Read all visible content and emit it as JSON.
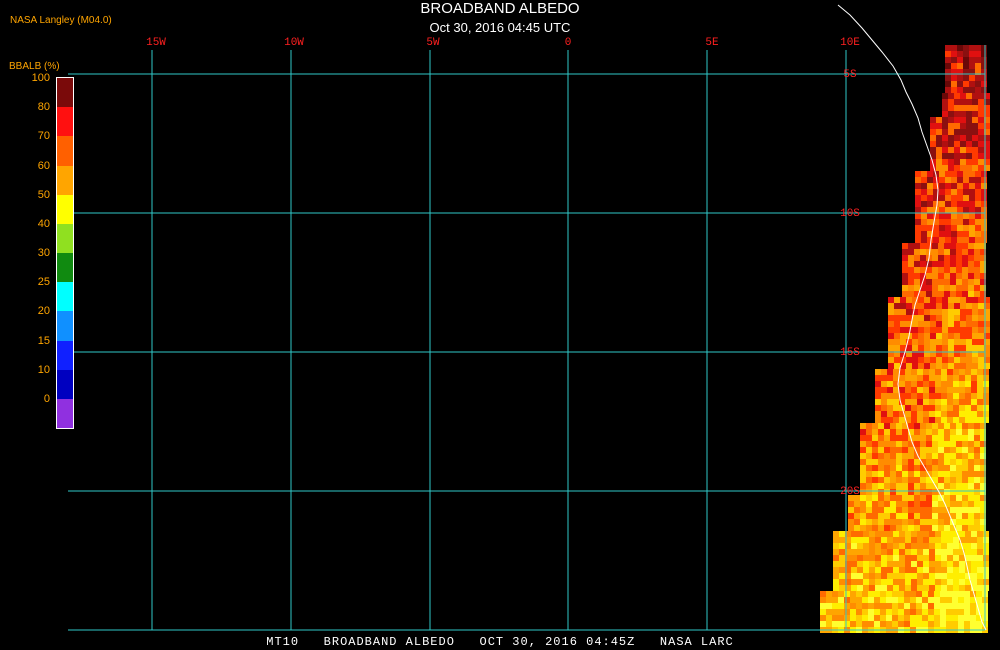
{
  "header": {
    "credit": "NASA Langley (M04.0)",
    "title": "BROADBAND ALBEDO",
    "subtitle": "Oct 30, 2016 04:45 UTC"
  },
  "legend": {
    "title": "BBALB (%)",
    "labels": [
      "100",
      "80",
      "70",
      "60",
      "50",
      "40",
      "30",
      "25",
      "20",
      "15",
      "10",
      "0"
    ],
    "colors": [
      "#7a0a0a",
      "#ff1010",
      "#ff6000",
      "#ffa500",
      "#ffff00",
      "#90e020",
      "#108a10",
      "#00ffff",
      "#1090ff",
      "#1020ff",
      "#0000c0",
      "#9030e0"
    ]
  },
  "grid": {
    "lon_labels": [
      "15W",
      "10W",
      "5W",
      "0",
      "5E",
      "10E"
    ],
    "lat_labels": [
      "5S",
      "10S",
      "15S",
      "20S"
    ],
    "grid_color": "#30c8c8"
  },
  "footer": "MT10   BROADBAND ALBEDO   OCT 30, 2016 04:45Z   NASA LARC"
}
